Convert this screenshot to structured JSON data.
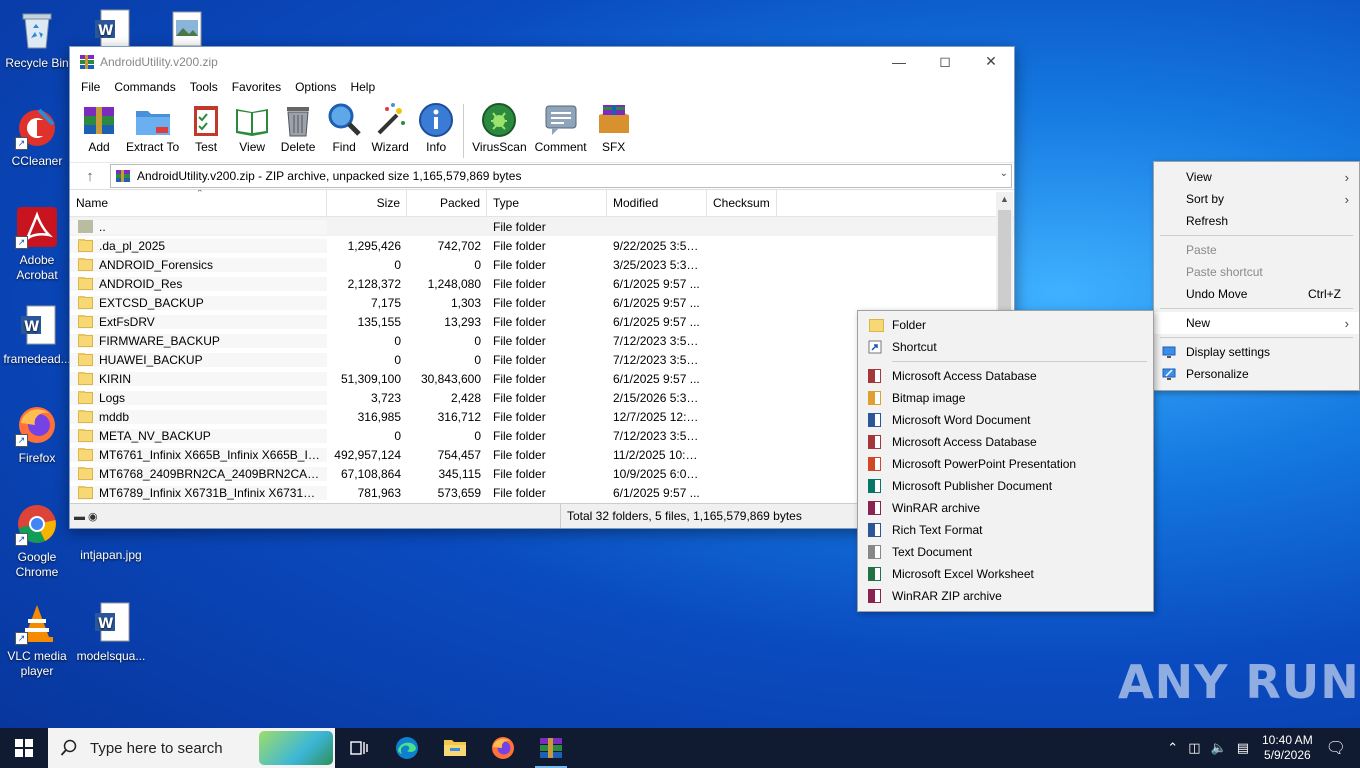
{
  "desktop": {
    "icons": [
      {
        "label": "Recycle Bin"
      },
      {
        "label": "CCleaner"
      },
      {
        "label": "Adobe Acrobat"
      },
      {
        "label": "framedead..."
      },
      {
        "label": "Firefox"
      },
      {
        "label": "Google Chrome"
      },
      {
        "label": "VLC media player"
      },
      {
        "label": "intjapan.jpg"
      },
      {
        "label": "modelsqua..."
      }
    ],
    "watermark": "ANY RUN"
  },
  "window": {
    "title": "AndroidUtility.v200.zip",
    "menu": [
      "File",
      "Commands",
      "Tools",
      "Favorites",
      "Options",
      "Help"
    ],
    "toolbar": [
      "Add",
      "Extract To",
      "Test",
      "View",
      "Delete",
      "Find",
      "Wizard",
      "Info",
      "VirusScan",
      "Comment",
      "SFX"
    ],
    "address": "AndroidUtility.v200.zip - ZIP archive, unpacked size 1,165,579,869 bytes",
    "columns": {
      "name": "Name",
      "size": "Size",
      "packed": "Packed",
      "type": "Type",
      "modified": "Modified",
      "checksum": "Checksum"
    },
    "rows": [
      {
        "name": "..",
        "size": "",
        "packed": "",
        "type": "File folder",
        "modified": ""
      },
      {
        "name": ".da_pl_2025",
        "size": "1,295,426",
        "packed": "742,702",
        "type": "File folder",
        "modified": "9/22/2025 3:59 ..."
      },
      {
        "name": "ANDROID_Forensics",
        "size": "0",
        "packed": "0",
        "type": "File folder",
        "modified": "3/25/2023 5:39 ..."
      },
      {
        "name": "ANDROID_Res",
        "size": "2,128,372",
        "packed": "1,248,080",
        "type": "File folder",
        "modified": "6/1/2025 9:57 ..."
      },
      {
        "name": "EXTCSD_BACKUP",
        "size": "7,175",
        "packed": "1,303",
        "type": "File folder",
        "modified": "6/1/2025 9:57 ..."
      },
      {
        "name": "ExtFsDRV",
        "size": "135,155",
        "packed": "13,293",
        "type": "File folder",
        "modified": "6/1/2025 9:57 ..."
      },
      {
        "name": "FIRMWARE_BACKUP",
        "size": "0",
        "packed": "0",
        "type": "File folder",
        "modified": "7/12/2023 3:53 ..."
      },
      {
        "name": "HUAWEI_BACKUP",
        "size": "0",
        "packed": "0",
        "type": "File folder",
        "modified": "7/12/2023 3:52 ..."
      },
      {
        "name": "KIRIN",
        "size": "51,309,100",
        "packed": "30,843,600",
        "type": "File folder",
        "modified": "6/1/2025 9:57 ..."
      },
      {
        "name": "Logs",
        "size": "3,723",
        "packed": "2,428",
        "type": "File folder",
        "modified": "2/15/2026 5:39 ..."
      },
      {
        "name": "mddb",
        "size": "316,985",
        "packed": "316,712",
        "type": "File folder",
        "modified": "12/7/2025 12:1..."
      },
      {
        "name": "META_NV_BACKUP",
        "size": "0",
        "packed": "0",
        "type": "File folder",
        "modified": "7/12/2023 3:52 ..."
      },
      {
        "name": "MT6761_Infinix X665B_Infinix X665B_INFIN...",
        "size": "492,957,124",
        "packed": "754,457",
        "type": "File folder",
        "modified": "11/2/2025 10:2..."
      },
      {
        "name": "MT6768_2409BRN2CA_2409BRN2CA_Xiao...",
        "size": "67,108,864",
        "packed": "345,115",
        "type": "File folder",
        "modified": "10/9/2025 6:09 ..."
      },
      {
        "name": "MT6789_Infinix X6731B_Infinix X6731B_INF...",
        "size": "781,963",
        "packed": "573,659",
        "type": "File folder",
        "modified": "6/1/2025 9:57 ..."
      }
    ],
    "status_total": "Total 32 folders, 5 files, 1,165,579,869 bytes"
  },
  "context_menu": {
    "view": "View",
    "sort_by": "Sort by",
    "refresh": "Refresh",
    "paste": "Paste",
    "paste_shortcut": "Paste shortcut",
    "undo_move": "Undo Move",
    "undo_shortcut": "Ctrl+Z",
    "new": "New",
    "display_settings": "Display settings",
    "personalize": "Personalize"
  },
  "new_menu": {
    "folder": "Folder",
    "shortcut": "Shortcut",
    "items": [
      {
        "label": "Microsoft Access Database",
        "color": "#a4373a"
      },
      {
        "label": "Bitmap image",
        "color": "#e0a030"
      },
      {
        "label": "Microsoft Word Document",
        "color": "#2b579a"
      },
      {
        "label": "Microsoft Access Database",
        "color": "#a4373a"
      },
      {
        "label": "Microsoft PowerPoint Presentation",
        "color": "#d24726"
      },
      {
        "label": "Microsoft Publisher Document",
        "color": "#077568"
      },
      {
        "label": "WinRAR archive",
        "color": "#8b2252"
      },
      {
        "label": "Rich Text Format",
        "color": "#2b579a"
      },
      {
        "label": "Text Document",
        "color": "#888888"
      },
      {
        "label": "Microsoft Excel Worksheet",
        "color": "#217346"
      },
      {
        "label": "WinRAR ZIP archive",
        "color": "#8b2252"
      }
    ]
  },
  "taskbar": {
    "search_placeholder": "Type here to search",
    "time": "10:40 AM",
    "date": "5/9/2026"
  }
}
